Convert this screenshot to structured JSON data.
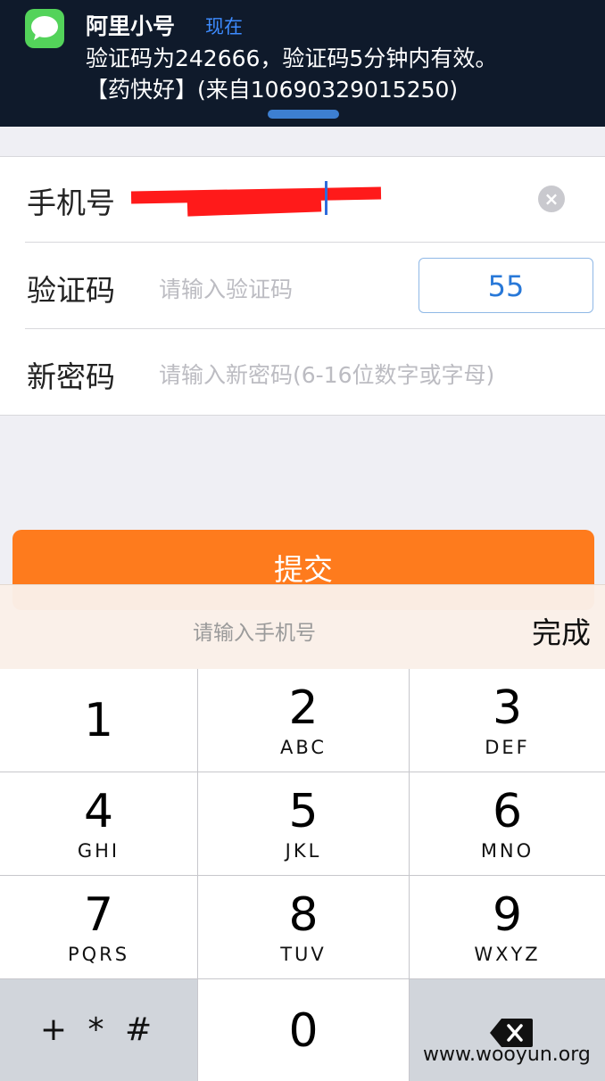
{
  "notification": {
    "app_icon": "messages-icon",
    "sender": "阿里小号",
    "time": "现在",
    "line1": "验证码为242666，验证码5分钟内有效。",
    "line2": "【药快好】(来自10690329015250)"
  },
  "form": {
    "phone": {
      "label": "手机号",
      "value_redacted": true
    },
    "code": {
      "label": "验证码",
      "placeholder": "请输入验证码",
      "button_label": "55"
    },
    "password": {
      "label": "新密码",
      "placeholder": "请输入新密码(6-16位数字或字母)"
    }
  },
  "submit_label": "提交",
  "keyboard": {
    "accessory_placeholder": "请输入手机号",
    "done_label": "完成",
    "keys": [
      {
        "num": "1",
        "letters": ""
      },
      {
        "num": "2",
        "letters": "ABC"
      },
      {
        "num": "3",
        "letters": "DEF"
      },
      {
        "num": "4",
        "letters": "GHI"
      },
      {
        "num": "5",
        "letters": "JKL"
      },
      {
        "num": "6",
        "letters": "MNO"
      },
      {
        "num": "7",
        "letters": "PQRS"
      },
      {
        "num": "8",
        "letters": "TUV"
      },
      {
        "num": "9",
        "letters": "WXYZ"
      }
    ],
    "symbols_label": "+ * #",
    "zero": "0",
    "delete_icon": "backspace-icon"
  },
  "watermark": "www.wooyun.org",
  "colors": {
    "accent_orange": "#fe7b1d",
    "link_blue": "#2878d8",
    "banner_bg": "#0f1a2b",
    "redaction_red": "#ff1a1a"
  }
}
